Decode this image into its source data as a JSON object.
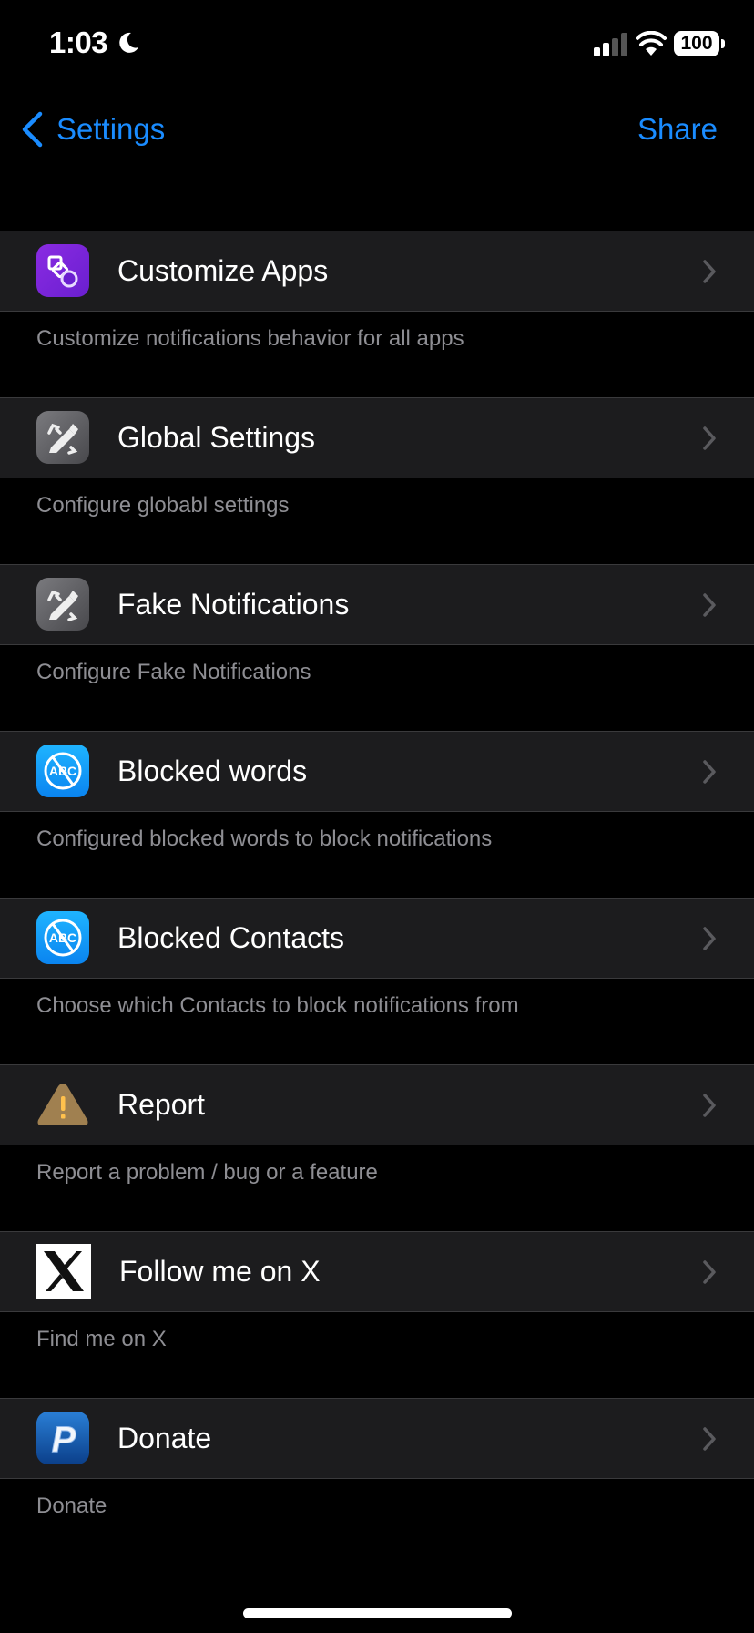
{
  "status_bar": {
    "time": "1:03",
    "focus_icon": "moon-icon",
    "signal_icon": "cellular-signal-icon",
    "wifi_icon": "wifi-icon",
    "battery_level": "100"
  },
  "nav": {
    "back_label": "Settings",
    "back_icon": "chevron-left-icon",
    "share_label": "Share"
  },
  "colors": {
    "accent": "#1a8cff",
    "cell_background": "#1c1c1e",
    "footer_text": "#8e8e93"
  },
  "items": [
    {
      "title": "Customize Apps",
      "footer": "Customize notifications behavior for all apps",
      "icon": "shapes-icon"
    },
    {
      "title": "Global Settings",
      "footer": "Configure globabl settings",
      "icon": "tools-icon"
    },
    {
      "title": "Fake Notifications",
      "footer": "Configure Fake Notifications",
      "icon": "tools-icon"
    },
    {
      "title": "Blocked words",
      "footer": "Configured blocked words to block notifications",
      "icon": "blocked-abc-icon"
    },
    {
      "title": "Blocked Contacts",
      "footer": "Choose which Contacts to block notifications from",
      "icon": "blocked-abc-icon"
    },
    {
      "title": "Report",
      "footer": "Report a problem / bug or a feature",
      "icon": "warning-icon"
    },
    {
      "title": "Follow me on X",
      "footer": "Find me on X",
      "icon": "x-logo-icon"
    },
    {
      "title": "Donate",
      "footer": "Donate",
      "icon": "paypal-icon"
    }
  ],
  "icon_text": {
    "abc": "ABC",
    "paypal": "P",
    "warning": "!"
  }
}
